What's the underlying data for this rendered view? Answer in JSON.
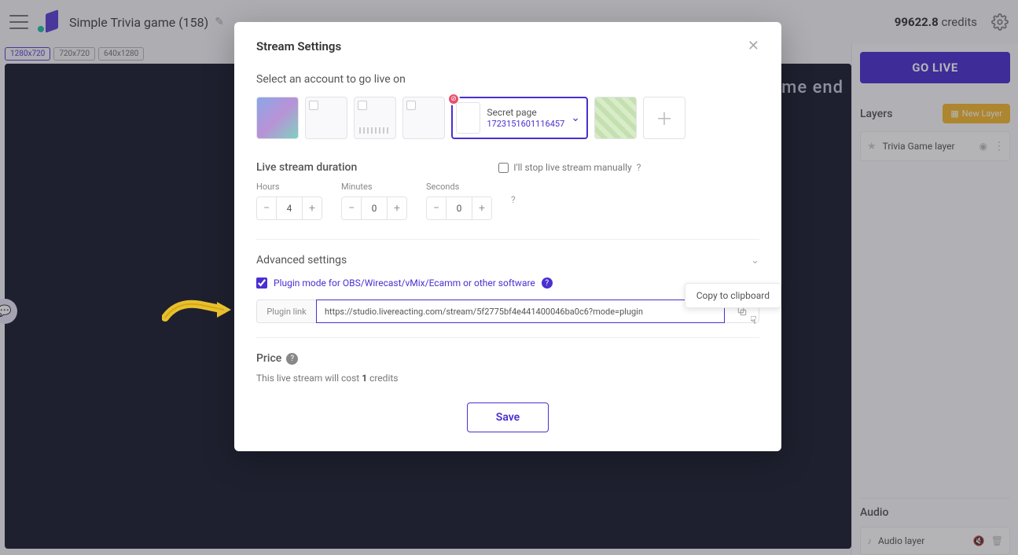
{
  "header": {
    "project_title": "Simple Trivia game (158)",
    "credits_value": "99622.8",
    "credits_label": "credits",
    "go_live": "GO LIVE"
  },
  "stage": {
    "resolutions": [
      "1280x720",
      "720x720",
      "640x1280"
    ],
    "active_resolution": 0,
    "overlay_text": "ame end"
  },
  "rightpanel": {
    "layers_title": "Layers",
    "new_layer": "New Layer",
    "layers": [
      {
        "name": "Trivia Game layer"
      }
    ],
    "audio_title": "Audio",
    "audio_layers": [
      {
        "name": "Audio layer"
      }
    ]
  },
  "modal": {
    "title": "Stream Settings",
    "select_account": "Select an account to go live on",
    "selected_account": {
      "title": "Secret page",
      "id": "1723151601116457"
    },
    "duration_label": "Live stream duration",
    "manual_stop_label": "I'll stop live stream manually",
    "hours_label": "Hours",
    "minutes_label": "Minutes",
    "seconds_label": "Seconds",
    "hours_value": "4",
    "minutes_value": "0",
    "seconds_value": "0",
    "advanced_label": "Advanced settings",
    "plugin_mode_label": "Plugin mode for OBS/Wirecast/vMix/Ecamm or other software",
    "plugin_link_label": "Plugin link",
    "plugin_link_value": "https://studio.livereacting.com/stream/5f2775bf4e441400046ba0c6?mode=plugin",
    "tooltip": "Copy to clipboard",
    "price_label": "Price",
    "price_prefix": "This live stream will cost ",
    "price_credits": "1",
    "price_suffix": " credits",
    "save": "Save"
  }
}
